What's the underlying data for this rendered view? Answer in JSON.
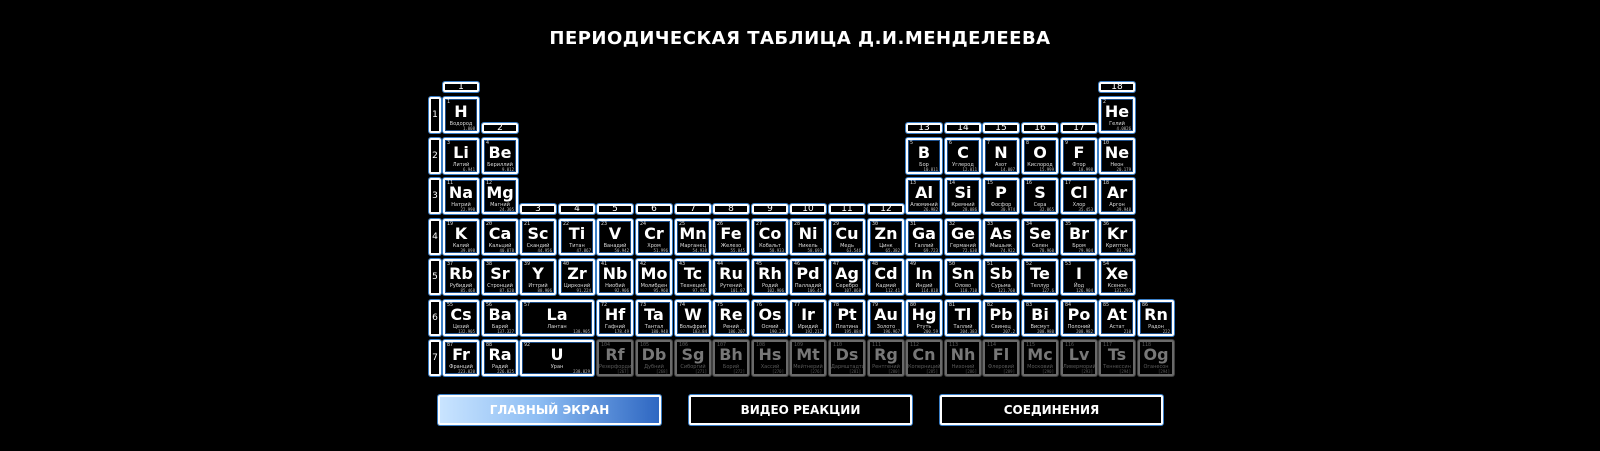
{
  "title": "ПЕРИОДИЧЕСКАЯ ТАБЛИЦА Д.И.МЕНДЕЛЕЕВА",
  "groups": [
    "1",
    "2",
    "3",
    "4",
    "5",
    "6",
    "7",
    "8",
    "9",
    "10",
    "11",
    "12",
    "13",
    "14",
    "15",
    "16",
    "17",
    "18"
  ],
  "periods": [
    "1",
    "2",
    "3",
    "4",
    "5",
    "6",
    "7"
  ],
  "elements": [
    {
      "n": "1",
      "s": "H",
      "name": "Водород",
      "m": "1.008",
      "p": 1,
      "g": 1
    },
    {
      "n": "2",
      "s": "He",
      "name": "Гелий",
      "m": "4.0026",
      "p": 1,
      "g": 18
    },
    {
      "n": "3",
      "s": "Li",
      "name": "Литий",
      "m": "6.941",
      "p": 2,
      "g": 1
    },
    {
      "n": "4",
      "s": "Be",
      "name": "Бериллий",
      "m": "9.012",
      "p": 2,
      "g": 2
    },
    {
      "n": "5",
      "s": "B",
      "name": "Бор",
      "m": "10.811",
      "p": 2,
      "g": 13
    },
    {
      "n": "6",
      "s": "C",
      "name": "Углерод",
      "m": "12.011",
      "p": 2,
      "g": 14
    },
    {
      "n": "7",
      "s": "N",
      "name": "Азот",
      "m": "14.007",
      "p": 2,
      "g": 15
    },
    {
      "n": "8",
      "s": "O",
      "name": "Кислород",
      "m": "15.999",
      "p": 2,
      "g": 16
    },
    {
      "n": "9",
      "s": "F",
      "name": "Фтор",
      "m": "18.998",
      "p": 2,
      "g": 17
    },
    {
      "n": "10",
      "s": "Ne",
      "name": "Неон",
      "m": "20.179",
      "p": 2,
      "g": 18
    },
    {
      "n": "11",
      "s": "Na",
      "name": "Натрий",
      "m": "22.990",
      "p": 3,
      "g": 1
    },
    {
      "n": "12",
      "s": "Mg",
      "name": "Магний",
      "m": "24.305",
      "p": 3,
      "g": 2
    },
    {
      "n": "13",
      "s": "Al",
      "name": "Алюминий",
      "m": "26.982",
      "p": 3,
      "g": 13
    },
    {
      "n": "14",
      "s": "Si",
      "name": "Кремний",
      "m": "28.086",
      "p": 3,
      "g": 14
    },
    {
      "n": "15",
      "s": "P",
      "name": "Фосфор",
      "m": "30.974",
      "p": 3,
      "g": 15
    },
    {
      "n": "16",
      "s": "S",
      "name": "Сера",
      "m": "32.065",
      "p": 3,
      "g": 16
    },
    {
      "n": "17",
      "s": "Cl",
      "name": "Хлор",
      "m": "35.453",
      "p": 3,
      "g": 17
    },
    {
      "n": "18",
      "s": "Ar",
      "name": "Аргон",
      "m": "39.948",
      "p": 3,
      "g": 18
    },
    {
      "n": "19",
      "s": "K",
      "name": "Калий",
      "m": "39.098",
      "p": 4,
      "g": 1
    },
    {
      "n": "20",
      "s": "Ca",
      "name": "Кальций",
      "m": "40.078",
      "p": 4,
      "g": 2
    },
    {
      "n": "21",
      "s": "Sc",
      "name": "Скандий",
      "m": "44.956",
      "p": 4,
      "g": 3
    },
    {
      "n": "22",
      "s": "Ti",
      "name": "Титан",
      "m": "47.867",
      "p": 4,
      "g": 4
    },
    {
      "n": "23",
      "s": "V",
      "name": "Ванадий",
      "m": "50.942",
      "p": 4,
      "g": 5
    },
    {
      "n": "24",
      "s": "Cr",
      "name": "Хром",
      "m": "51.996",
      "p": 4,
      "g": 6
    },
    {
      "n": "25",
      "s": "Mn",
      "name": "Марганец",
      "m": "54.938",
      "p": 4,
      "g": 7
    },
    {
      "n": "26",
      "s": "Fe",
      "name": "Железо",
      "m": "55.845",
      "p": 4,
      "g": 8
    },
    {
      "n": "27",
      "s": "Co",
      "name": "Кобальт",
      "m": "58.933",
      "p": 4,
      "g": 9
    },
    {
      "n": "28",
      "s": "Ni",
      "name": "Никель",
      "m": "58.693",
      "p": 4,
      "g": 10
    },
    {
      "n": "29",
      "s": "Cu",
      "name": "Медь",
      "m": "63.546",
      "p": 4,
      "g": 11
    },
    {
      "n": "30",
      "s": "Zn",
      "name": "Цинк",
      "m": "65.382",
      "p": 4,
      "g": 12
    },
    {
      "n": "31",
      "s": "Ga",
      "name": "Галлий",
      "m": "69.723",
      "p": 4,
      "g": 13
    },
    {
      "n": "32",
      "s": "Ge",
      "name": "Германий",
      "m": "72.630",
      "p": 4,
      "g": 14
    },
    {
      "n": "33",
      "s": "As",
      "name": "Мышьяк",
      "m": "74.922",
      "p": 4,
      "g": 15
    },
    {
      "n": "34",
      "s": "Se",
      "name": "Селен",
      "m": "78.960",
      "p": 4,
      "g": 16
    },
    {
      "n": "35",
      "s": "Br",
      "name": "Бром",
      "m": "79.904",
      "p": 4,
      "g": 17
    },
    {
      "n": "36",
      "s": "Kr",
      "name": "Криптон",
      "m": "83.798",
      "p": 4,
      "g": 18
    },
    {
      "n": "37",
      "s": "Rb",
      "name": "Рубидий",
      "m": "85.468",
      "p": 5,
      "g": 1
    },
    {
      "n": "38",
      "s": "Sr",
      "name": "Стронций",
      "m": "87.620",
      "p": 5,
      "g": 2
    },
    {
      "n": "39",
      "s": "Y",
      "name": "Иттрий",
      "m": "88.906",
      "p": 5,
      "g": 3
    },
    {
      "n": "40",
      "s": "Zr",
      "name": "Цирконий",
      "m": "91.224",
      "p": 5,
      "g": 4
    },
    {
      "n": "41",
      "s": "Nb",
      "name": "Ниобий",
      "m": "92.906",
      "p": 5,
      "g": 5
    },
    {
      "n": "42",
      "s": "Mo",
      "name": "Молибден",
      "m": "95.960",
      "p": 5,
      "g": 6
    },
    {
      "n": "43",
      "s": "Tc",
      "name": "Технеций",
      "m": "97.907",
      "p": 5,
      "g": 7
    },
    {
      "n": "44",
      "s": "Ru",
      "name": "Рутений",
      "m": "101.07",
      "p": 5,
      "g": 8
    },
    {
      "n": "45",
      "s": "Rh",
      "name": "Родий",
      "m": "102.906",
      "p": 5,
      "g": 9
    },
    {
      "n": "46",
      "s": "Pd",
      "name": "Палладий",
      "m": "106.42",
      "p": 5,
      "g": 10
    },
    {
      "n": "47",
      "s": "Ag",
      "name": "Серебро",
      "m": "107.868",
      "p": 5,
      "g": 11
    },
    {
      "n": "48",
      "s": "Cd",
      "name": "Кадмий",
      "m": "112.41",
      "p": 5,
      "g": 12
    },
    {
      "n": "49",
      "s": "In",
      "name": "Индий",
      "m": "114.818",
      "p": 5,
      "g": 13
    },
    {
      "n": "50",
      "s": "Sn",
      "name": "Олово",
      "m": "118.710",
      "p": 5,
      "g": 14
    },
    {
      "n": "51",
      "s": "Sb",
      "name": "Сурьма",
      "m": "121.760",
      "p": 5,
      "g": 15
    },
    {
      "n": "52",
      "s": "Te",
      "name": "Теллур",
      "m": "127.6",
      "p": 5,
      "g": 16
    },
    {
      "n": "53",
      "s": "I",
      "name": "Йод",
      "m": "126.904",
      "p": 5,
      "g": 17
    },
    {
      "n": "54",
      "s": "Xe",
      "name": "Ксенон",
      "m": "131.293",
      "p": 5,
      "g": 18
    },
    {
      "n": "55",
      "s": "Cs",
      "name": "Цезий",
      "m": "132.905",
      "p": 6,
      "g": 1
    },
    {
      "n": "56",
      "s": "Ba",
      "name": "Барий",
      "m": "137.327",
      "p": 6,
      "g": 2
    },
    {
      "n": "57",
      "s": "La",
      "name": "Лантан",
      "m": "138.905",
      "p": 6,
      "g": 3,
      "wide": true
    },
    {
      "n": "72",
      "s": "Hf",
      "name": "Гафний",
      "m": "178.49",
      "p": 6,
      "g": 5
    },
    {
      "n": "73",
      "s": "Ta",
      "name": "Тантал",
      "m": "180.948",
      "p": 6,
      "g": 6
    },
    {
      "n": "74",
      "s": "W",
      "name": "Вольфрам",
      "m": "183.84",
      "p": 6,
      "g": 7
    },
    {
      "n": "75",
      "s": "Re",
      "name": "Рений",
      "m": "186.207",
      "p": 6,
      "g": 8
    },
    {
      "n": "76",
      "s": "Os",
      "name": "Осмий",
      "m": "190.23",
      "p": 6,
      "g": 9
    },
    {
      "n": "77",
      "s": "Ir",
      "name": "Иридий",
      "m": "192.217",
      "p": 6,
      "g": 10
    },
    {
      "n": "78",
      "s": "Pt",
      "name": "Платина",
      "m": "195.084",
      "p": 6,
      "g": 11
    },
    {
      "n": "79",
      "s": "Au",
      "name": "Золото",
      "m": "196.967",
      "p": 6,
      "g": 12
    },
    {
      "n": "80",
      "s": "Hg",
      "name": "Ртуть",
      "m": "200.59",
      "p": 6,
      "g": 13
    },
    {
      "n": "81",
      "s": "Tl",
      "name": "Таллий",
      "m": "204.383",
      "p": 6,
      "g": 14
    },
    {
      "n": "82",
      "s": "Pb",
      "name": "Свинец",
      "m": "207.2",
      "p": 6,
      "g": 15
    },
    {
      "n": "83",
      "s": "Bi",
      "name": "Висмут",
      "m": "208.980",
      "p": 6,
      "g": 16
    },
    {
      "n": "84",
      "s": "Po",
      "name": "Полоний",
      "m": "208.982",
      "p": 6,
      "g": 17
    },
    {
      "n": "85",
      "s": "At",
      "name": "Астат",
      "m": "210",
      "p": 6,
      "g": 18
    },
    {
      "n": "86",
      "s": "Rn",
      "name": "Радон",
      "m": "222",
      "p": 6,
      "g": 19
    },
    {
      "n": "87",
      "s": "Fr",
      "name": "Франций",
      "m": "223.020",
      "p": 7,
      "g": 1
    },
    {
      "n": "88",
      "s": "Ra",
      "name": "Радий",
      "m": "226.025",
      "p": 7,
      "g": 2
    },
    {
      "n": "92",
      "s": "U",
      "name": "Уран",
      "m": "238.029",
      "p": 7,
      "g": 3,
      "wide": true
    },
    {
      "n": "104",
      "s": "Rf",
      "name": "Резерфордий",
      "m": "[267]",
      "p": 7,
      "g": 5,
      "dim": true
    },
    {
      "n": "105",
      "s": "Db",
      "name": "Дубний",
      "m": "[268]",
      "p": 7,
      "g": 6,
      "dim": true
    },
    {
      "n": "106",
      "s": "Sg",
      "name": "Сиборгий",
      "m": "[271]",
      "p": 7,
      "g": 7,
      "dim": true
    },
    {
      "n": "107",
      "s": "Bh",
      "name": "Борий",
      "m": "[272]",
      "p": 7,
      "g": 8,
      "dim": true
    },
    {
      "n": "108",
      "s": "Hs",
      "name": "Хассий",
      "m": "[270]",
      "p": 7,
      "g": 9,
      "dim": true
    },
    {
      "n": "109",
      "s": "Mt",
      "name": "Мейтнерий",
      "m": "[276]",
      "p": 7,
      "g": 10,
      "dim": true
    },
    {
      "n": "110",
      "s": "Ds",
      "name": "Дармштадтий",
      "m": "[281]",
      "p": 7,
      "g": 11,
      "dim": true
    },
    {
      "n": "111",
      "s": "Rg",
      "name": "Рентгений",
      "m": "[280]",
      "p": 7,
      "g": 12,
      "dim": true
    },
    {
      "n": "112",
      "s": "Cn",
      "name": "Коперниций",
      "m": "[285]",
      "p": 7,
      "g": 13,
      "dim": true
    },
    {
      "n": "113",
      "s": "Nh",
      "name": "Нихоний",
      "m": "[286]",
      "p": 7,
      "g": 14,
      "dim": true
    },
    {
      "n": "114",
      "s": "Fl",
      "name": "Флеровий",
      "m": "[289]",
      "p": 7,
      "g": 15,
      "dim": true
    },
    {
      "n": "115",
      "s": "Mc",
      "name": "Московий",
      "m": "[290]",
      "p": 7,
      "g": 16,
      "dim": true
    },
    {
      "n": "116",
      "s": "Lv",
      "name": "Ливерморий",
      "m": "[293]",
      "p": 7,
      "g": 17,
      "dim": true
    },
    {
      "n": "117",
      "s": "Ts",
      "name": "Теннессин",
      "m": "[294]",
      "p": 7,
      "g": 18,
      "dim": true
    },
    {
      "n": "118",
      "s": "Og",
      "name": "Оганесон",
      "m": "[294]",
      "p": 7,
      "g": 19,
      "dim": true
    }
  ],
  "buttons": {
    "main": "ГЛАВНЫЙ ЭКРАН",
    "video": "ВИДЕО РЕАКЦИИ",
    "compounds": "СОЕДИНЕНИЯ"
  },
  "colors": {
    "accent": "#3a7fc8",
    "active_gradient_start": "#c9e4ff",
    "active_gradient_end": "#2e67c2"
  }
}
